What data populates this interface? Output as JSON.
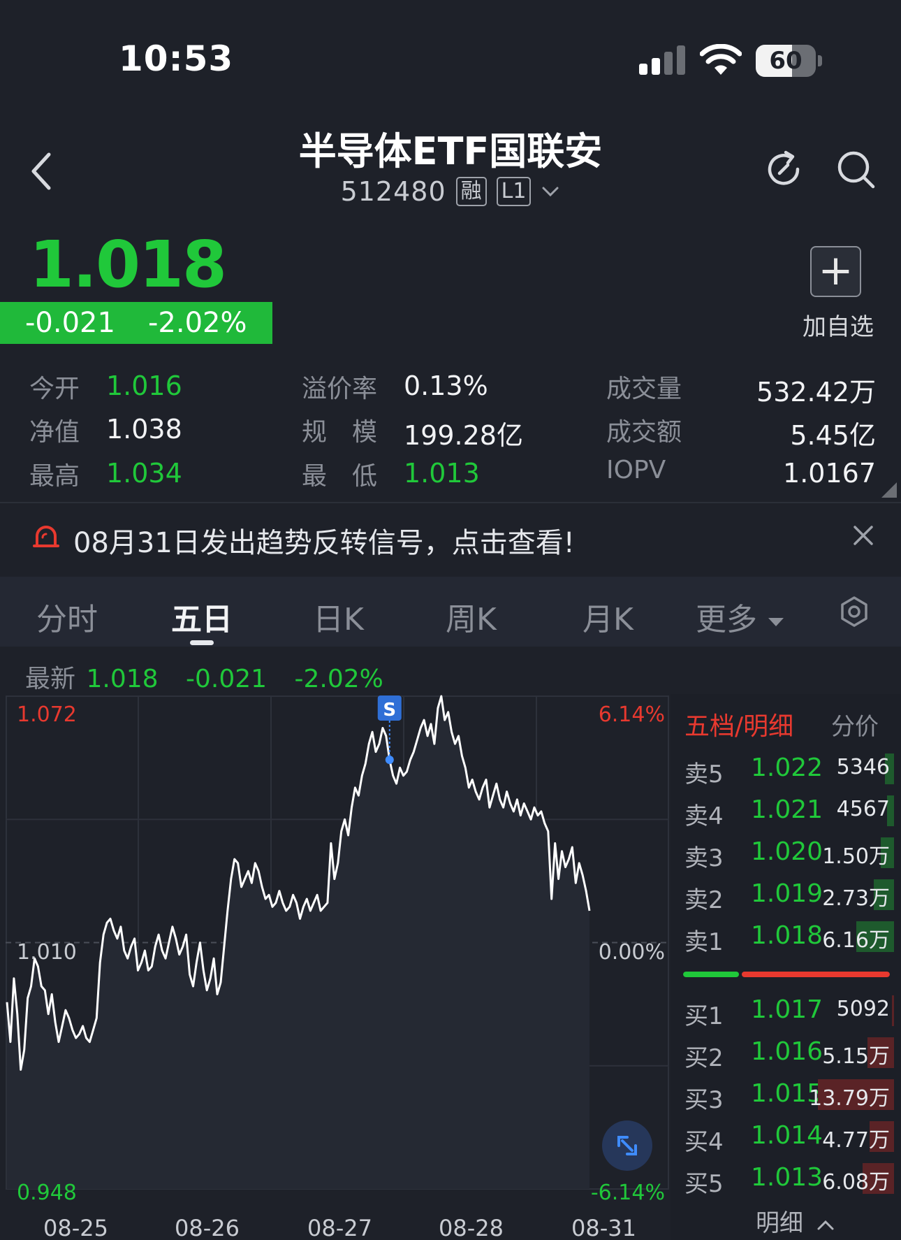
{
  "status_bar": {
    "time": "10:53",
    "battery": "60",
    "battery_level": 0.6
  },
  "header": {
    "title": "半导体ETF国联安",
    "code": "512480",
    "tag_margin": "融",
    "tag_level": "L1"
  },
  "quote": {
    "price": "1.018",
    "change": "-0.021",
    "change_pct": "-2.02%",
    "add_watch_label": "加自选"
  },
  "stats": {
    "open_label": "今开",
    "open_value": "1.016",
    "nav_label": "净值",
    "nav_value": "1.038",
    "high_label": "最高",
    "high_value": "1.034",
    "premium_label": "溢价率",
    "premium_value": "0.13%",
    "scale_label": "规　模",
    "scale_value": "199.28亿",
    "low_label": "最　低",
    "low_value": "1.013",
    "volume_label": "成交量",
    "volume_value": "532.42万",
    "amount_label": "成交额",
    "amount_value": "5.45亿",
    "iopv_label": "IOPV",
    "iopv_value": "1.0167"
  },
  "banner": {
    "text": "08月31日发出趋势反转信号，点击查看!"
  },
  "tabs": [
    {
      "label": "分时"
    },
    {
      "label": "五日"
    },
    {
      "label": "日K"
    },
    {
      "label": "周K"
    },
    {
      "label": "月K"
    },
    {
      "label": "更多"
    }
  ],
  "latest": {
    "label": "最新",
    "price": "1.018",
    "change": "-0.021",
    "pct": "-2.02%"
  },
  "chart_data": {
    "type": "line",
    "x_dates": [
      "08-25",
      "08-26",
      "08-27",
      "08-28",
      "08-31"
    ],
    "ylim": [
      0.948,
      1.072
    ],
    "y_labels": {
      "top": "1.072",
      "mid": "1.010",
      "bottom": "0.948"
    },
    "pct_labels": {
      "top": "6.14%",
      "mid": "0.00%",
      "bottom": "-6.14%"
    },
    "reference": 1.01,
    "signal_marker": "S",
    "series": [
      {
        "values": [
          0.995,
          0.985,
          1.001,
          0.992,
          0.978,
          0.983,
          0.996,
          0.999,
          1.006,
          1.004,
          0.999,
          0.998,
          0.992,
          0.997,
          0.99,
          0.985,
          0.989,
          0.993,
          0.991,
          0.988,
          0.986,
          0.987,
          0.989,
          0.986,
          0.985,
          0.988,
          0.991,
          1.005,
          1.012,
          1.015,
          1.016,
          1.013,
          1.011,
          1.014,
          1.008,
          1.006,
          1.009,
          1.011,
          1.003,
          1.005,
          1.008,
          1.003,
          1.004,
          1.009,
          1.012,
          1.008,
          1.006,
          1.01,
          1.014,
          1.011,
          1.007,
          1.009,
          1.012,
          1.002,
          0.999,
          1.005,
          1.01,
          1.003,
          0.998,
          1.001,
          1.006,
          0.997,
          1.0,
          1.009,
          1.018,
          1.026,
          1.031,
          1.03,
          1.024,
          1.026,
          1.028,
          1.025,
          1.03,
          1.028,
          1.024,
          1.021,
          1.022,
          1.019,
          1.02,
          1.023,
          1.02,
          1.018,
          1.019,
          1.022,
          1.02,
          1.016,
          1.019,
          1.021,
          1.018,
          1.02,
          1.022,
          1.018,
          1.019,
          1.02,
          1.035,
          1.026,
          1.03,
          1.038,
          1.041,
          1.037,
          1.044,
          1.049,
          1.047,
          1.052,
          1.055,
          1.06,
          1.063,
          1.058,
          1.06,
          1.064,
          1.062,
          1.056,
          1.052,
          1.05,
          1.054,
          1.052,
          1.053,
          1.056,
          1.058,
          1.061,
          1.064,
          1.066,
          1.062,
          1.065,
          1.06,
          1.069,
          1.072,
          1.066,
          1.068,
          1.063,
          1.06,
          1.062,
          1.057,
          1.054,
          1.049,
          1.051,
          1.048,
          1.046,
          1.049,
          1.051,
          1.044,
          1.047,
          1.05,
          1.046,
          1.044,
          1.048,
          1.045,
          1.043,
          1.046,
          1.042,
          1.045,
          1.043,
          1.041,
          1.044,
          1.042,
          1.043,
          1.04,
          1.038,
          1.021,
          1.035,
          1.026,
          1.033,
          1.029,
          1.031,
          1.034,
          1.025,
          1.03,
          1.027,
          1.023,
          1.018
        ]
      }
    ]
  },
  "orderbook": {
    "title": "五档/明细",
    "mode": "分价",
    "detail": "明细",
    "asks": [
      {
        "label": "卖5",
        "price": "1.022",
        "qty": "5346",
        "bar": 0.04,
        "bar_color": "#1e5a2d"
      },
      {
        "label": "卖4",
        "price": "1.021",
        "qty": "4567",
        "bar": 0.03,
        "bar_color": "#1e5a2d"
      },
      {
        "label": "卖3",
        "price": "1.020",
        "qty": "1.50万",
        "bar": 0.06,
        "bar_color": "#1e5a2d"
      },
      {
        "label": "卖2",
        "price": "1.019",
        "qty": "2.73万",
        "bar": 0.09,
        "bar_color": "#1e5a2d"
      },
      {
        "label": "卖1",
        "price": "1.018",
        "qty": "6.16万",
        "bar": 0.17,
        "bar_color": "#1e5a2d"
      }
    ],
    "bids": [
      {
        "label": "买1",
        "price": "1.017",
        "qty": "5092",
        "bar": 0.01,
        "bar_color": "#5a2326"
      },
      {
        "label": "买2",
        "price": "1.016",
        "qty": "5.15万",
        "bar": 0.12,
        "bar_color": "#5a2326"
      },
      {
        "label": "买3",
        "price": "1.015",
        "qty": "13.79万",
        "bar": 0.34,
        "bar_color": "#5a2326"
      },
      {
        "label": "买4",
        "price": "1.014",
        "qty": "4.77万",
        "bar": 0.11,
        "bar_color": "#5a2326"
      },
      {
        "label": "买5",
        "price": "1.013",
        "qty": "6.08万",
        "bar": 0.14,
        "bar_color": "#5a2326"
      }
    ],
    "buy_ratio": 0.27,
    "colors": {
      "up": "#e8392f",
      "down": "#20c83a"
    }
  }
}
